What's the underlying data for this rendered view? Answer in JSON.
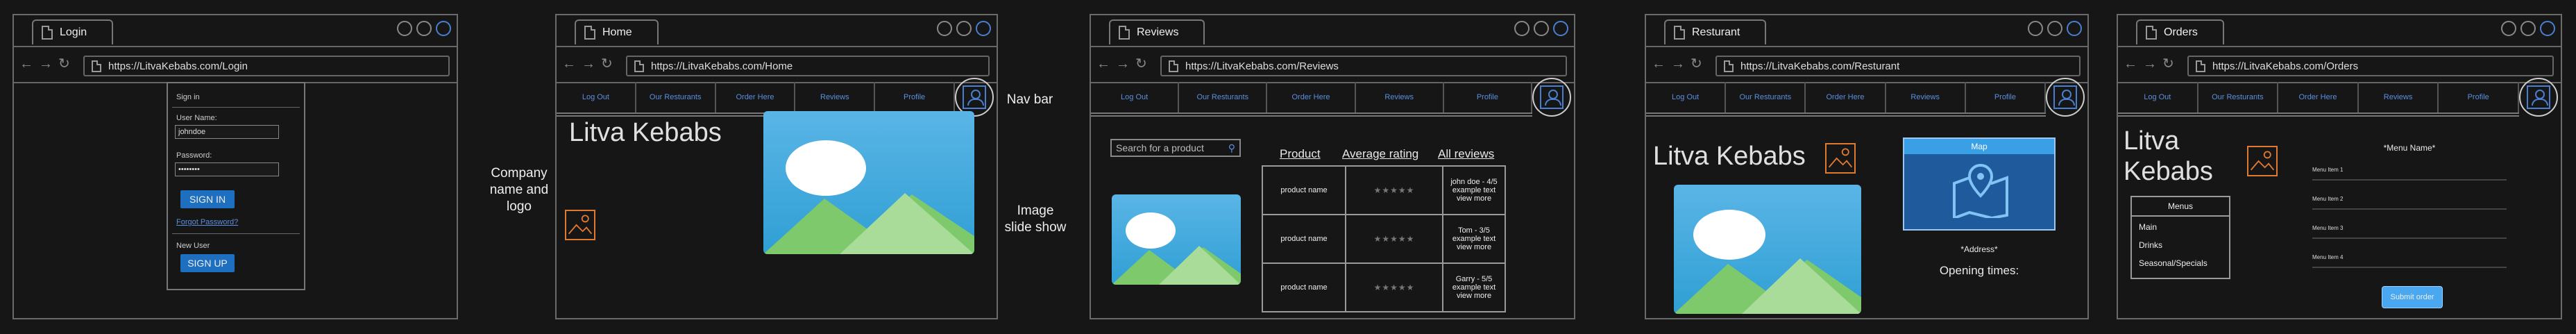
{
  "annotations": {
    "company": "Company name and logo",
    "navbar": "Nav bar",
    "slideshow": "Image slide show"
  },
  "icons": {
    "back": "arrow-left-icon",
    "forward": "arrow-right-icon",
    "refresh": "refresh-icon",
    "page": "page-icon",
    "profile": "user-profile-icon",
    "search": "search-icon",
    "map_pin": "map-pin-icon"
  },
  "colors": {
    "accent": "#1e6fc0",
    "link": "#5b8fe0",
    "logo": "#e07a30",
    "sky": "#3aa9dd"
  },
  "login": {
    "tab": "Login",
    "url": "https://LitvaKebabs.com/Login",
    "signin_title": "Sign in",
    "username_label": "User Name:",
    "username_value": "johndoe",
    "password_label": "Password:",
    "password_value": "••••••••",
    "signin_button": "SIGN IN",
    "forgot": "Forgot Password?",
    "new_user": "New User",
    "signup_button": "SIGN UP"
  },
  "home": {
    "tab": "Home",
    "url": "https://LitvaKebabs.com/Home",
    "nav": [
      "Log Out",
      "Our Resturants",
      "Order Here",
      "Reviews",
      "Profile"
    ],
    "brand": "Litva Kebabs"
  },
  "reviews": {
    "tab": "Reviews",
    "url": "https://LitvaKebabs.com/Reviews",
    "nav": [
      "Log Out",
      "Our Resturants",
      "Order Here",
      "Reviews",
      "Profile"
    ],
    "search_placeholder": "Search for a product",
    "columns": [
      "Product",
      "Average rating",
      "All reviews"
    ],
    "rows": [
      {
        "product": "product name",
        "rating": "★★★★★",
        "review": "john doe - 4/5 example text view more"
      },
      {
        "product": "product name",
        "rating": "★★★★★",
        "review": "Tom - 3/5 example text view more"
      },
      {
        "product": "product name",
        "rating": "★★★★★",
        "review": "Garry - 5/5 example text view more"
      }
    ]
  },
  "restaurant": {
    "tab": "Resturant",
    "url": "https://LitvaKebabs.com/Resturant",
    "nav": [
      "Log Out",
      "Our Resturants",
      "Order Here",
      "Reviews",
      "Profile"
    ],
    "brand": "Litva Kebabs",
    "map_title": "Map",
    "address": "*Address*",
    "opening": "Opening times:"
  },
  "orders": {
    "tab": "Orders",
    "url": "https://LitvaKebabs.com/Orders",
    "nav": [
      "Log Out",
      "Our Resturants",
      "Order Here",
      "Reviews",
      "Profile"
    ],
    "brand_line1": "Litva",
    "brand_line2": "Kebabs",
    "menu_header": "Menus",
    "menus": [
      "Main",
      "Drinks",
      "Seasonal/Specials"
    ],
    "menu_name": "*Menu Name*",
    "items": [
      "Menu Item 1",
      "Menu Item 2",
      "Menu Item 3",
      "Menu Item 4"
    ],
    "submit": "Submit order"
  }
}
